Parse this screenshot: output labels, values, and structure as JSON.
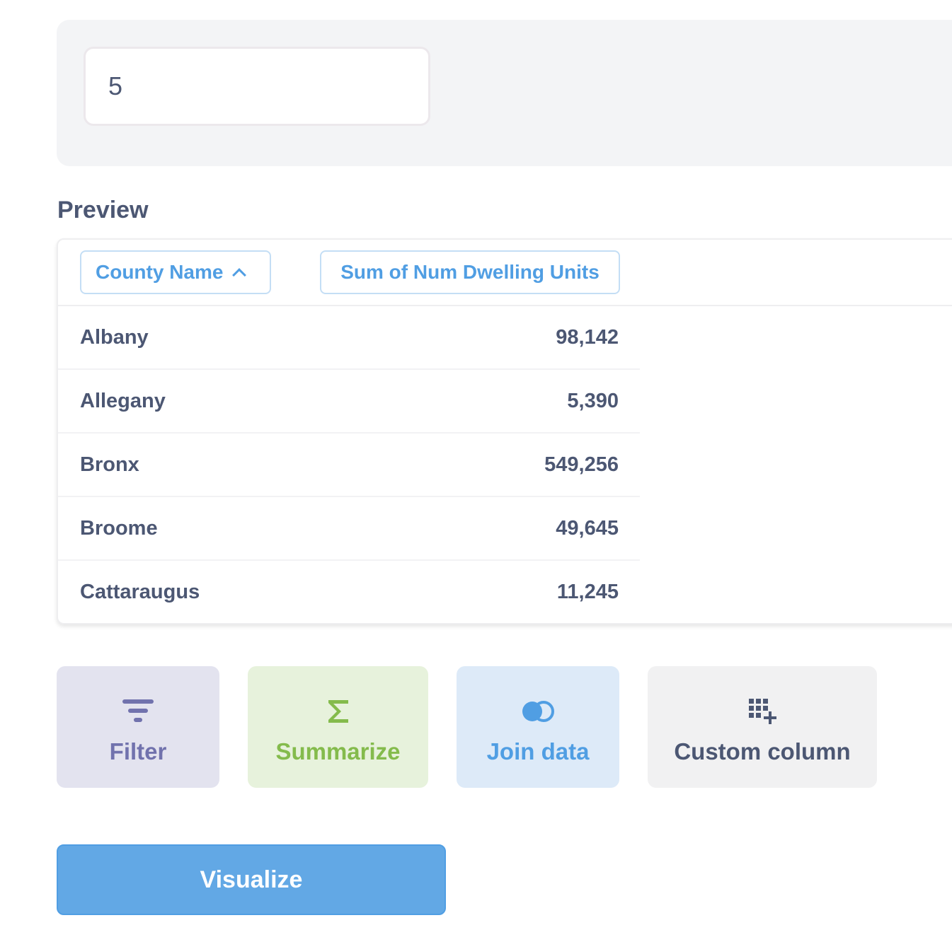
{
  "limit": {
    "value": "5"
  },
  "preview": {
    "title": "Preview",
    "columns": [
      {
        "label": "County Name",
        "sorted": "ascending"
      },
      {
        "label": "Sum of Num Dwelling Units"
      }
    ],
    "rows": [
      {
        "county": "Albany",
        "sum": "98,142"
      },
      {
        "county": "Allegany",
        "sum": "5,390"
      },
      {
        "county": "Bronx",
        "sum": "549,256"
      },
      {
        "county": "Broome",
        "sum": "49,645"
      },
      {
        "county": "Cattaraugus",
        "sum": "11,245"
      }
    ]
  },
  "actions": {
    "filter": {
      "label": "Filter",
      "icon": "filter-icon",
      "color": "#7172ad"
    },
    "summarize": {
      "label": "Summarize",
      "icon": "sigma-icon",
      "color": "#84bb4c"
    },
    "join": {
      "label": "Join data",
      "icon": "join-icon",
      "color": "#509ee3"
    },
    "custom": {
      "label": "Custom column",
      "icon": "add-column-icon",
      "color": "#4c5773"
    }
  },
  "visualize": {
    "label": "Visualize",
    "color": "#509ee3"
  }
}
